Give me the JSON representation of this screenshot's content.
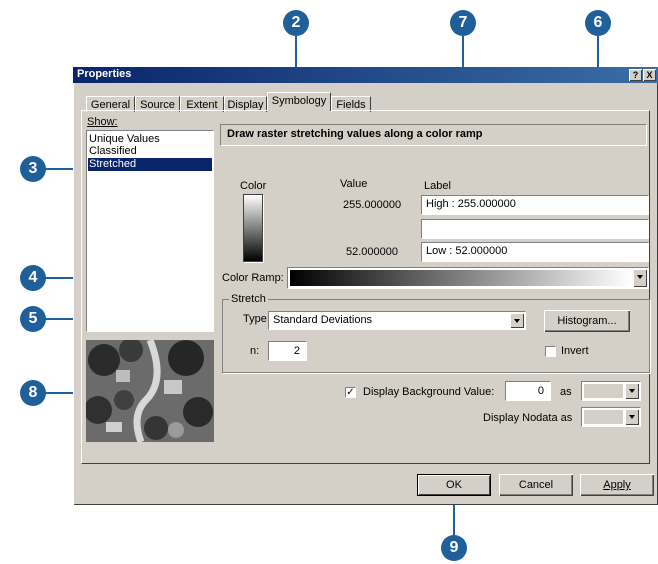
{
  "window": {
    "title": "Properties",
    "help_glyph": "?",
    "close_glyph": "X"
  },
  "tabs": [
    "General",
    "Source",
    "Extent",
    "Display",
    "Symbology",
    "Fields"
  ],
  "active_tab": "Symbology",
  "show": {
    "label": "Show:",
    "items": [
      "Unique Values",
      "Classified",
      "Stretched"
    ],
    "selected": "Stretched"
  },
  "header": "Draw raster stretching values along a color ramp",
  "columns": {
    "color": "Color",
    "value": "Value",
    "label": "Label"
  },
  "rows": [
    {
      "value": "255.000000",
      "label": "High : 255.000000"
    },
    {
      "value": "",
      "label": ""
    },
    {
      "value": "52.000000",
      "label": "Low : 52.000000"
    }
  ],
  "color_ramp": {
    "label": "Color Ramp:"
  },
  "stretch": {
    "group_label": "Stretch",
    "type_label": "Type:",
    "type_value": "Standard Deviations",
    "histogram_button": "Histogram...",
    "n_label": "n:",
    "n_value": "2",
    "invert_label": "Invert",
    "invert_checked": false
  },
  "background": {
    "label": "Display Background Value:",
    "checked": true,
    "value": "0",
    "as_label": "as"
  },
  "nodata": {
    "label": "Display Nodata as"
  },
  "buttons": {
    "ok": "OK",
    "cancel": "Cancel",
    "apply": "Apply"
  },
  "callouts": [
    "2",
    "7",
    "6",
    "3",
    "4",
    "5",
    "8",
    "9"
  ],
  "colors": {
    "callout": "#1f5f9a",
    "titlebar": "#0a246a",
    "selection": "#0a246a",
    "face": "#d4d0c8"
  }
}
